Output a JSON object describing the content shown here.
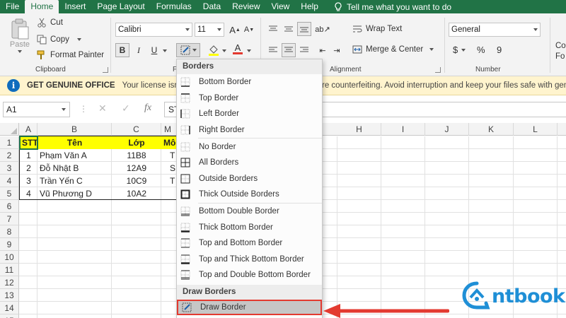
{
  "tabs": [
    "File",
    "Home",
    "Insert",
    "Page Layout",
    "Formulas",
    "Data",
    "Review",
    "View",
    "Help"
  ],
  "active_tab": "Home",
  "tell_me": "Tell me what you want to do",
  "clipboard": {
    "paste": "Paste",
    "cut": "Cut",
    "copy": "Copy",
    "format_painter": "Format Painter",
    "label": "Clipboard"
  },
  "font": {
    "name": "Calibri",
    "size": "11",
    "bold": "B",
    "italic": "I",
    "underline": "U",
    "label_partial": "F"
  },
  "alignment": {
    "wrap_text": "Wrap Text",
    "merge_center": "Merge & Center",
    "label": "Alignment"
  },
  "number": {
    "format": "General",
    "currency": "$",
    "percent": "%",
    "comma": "9",
    "label": "Number"
  },
  "styles_partial": "Co",
  "styles_partial2": "Fo",
  "message_bar": {
    "title": "GET GENUINE OFFICE",
    "text_left": "Your license isn't g",
    "text_right": "re counterfeiting. Avoid interruption and keep your files safe with genu"
  },
  "formula_bar": {
    "name_box": "A1",
    "content": "ST"
  },
  "columns": [
    "A",
    "B",
    "C",
    "",
    "",
    "H",
    "I",
    "J",
    "K",
    "L"
  ],
  "column_partial": "M",
  "rows": [
    "1",
    "2",
    "3",
    "4",
    "5",
    "6",
    "7",
    "8",
    "9",
    "10",
    "11",
    "12",
    "13",
    "14",
    "15"
  ],
  "table": {
    "headers": [
      "STT",
      "Tên",
      "Lớp",
      "Mô"
    ],
    "rows": [
      [
        "1",
        "Phạm Văn A",
        "11B8",
        "T"
      ],
      [
        "2",
        "Đỗ Nhật B",
        "12A9",
        "S"
      ],
      [
        "3",
        "Trần Yến C",
        "10C9",
        "T"
      ],
      [
        "4",
        "Vũ Phương D",
        "10A2",
        ""
      ]
    ],
    "header_color": "#ffff00"
  },
  "borders_menu": {
    "title": "Borders",
    "groups": [
      [
        "Bottom Border",
        "Top Border",
        "Left Border",
        "Right Border"
      ],
      [
        "No Border",
        "All Borders",
        "Outside Borders",
        "Thick Outside Borders"
      ],
      [
        "Bottom Double Border",
        "Thick Bottom Border",
        "Top and Bottom Border",
        "Top and Thick Bottom Border",
        "Top and Double Bottom Border"
      ]
    ],
    "draw_title": "Draw Borders",
    "draw_border": "Draw Border"
  },
  "logo": "ntbook",
  "colors": {
    "excel_green": "#217346",
    "highlight_red": "#e33a30",
    "logo_blue": "#1f8fd6"
  }
}
